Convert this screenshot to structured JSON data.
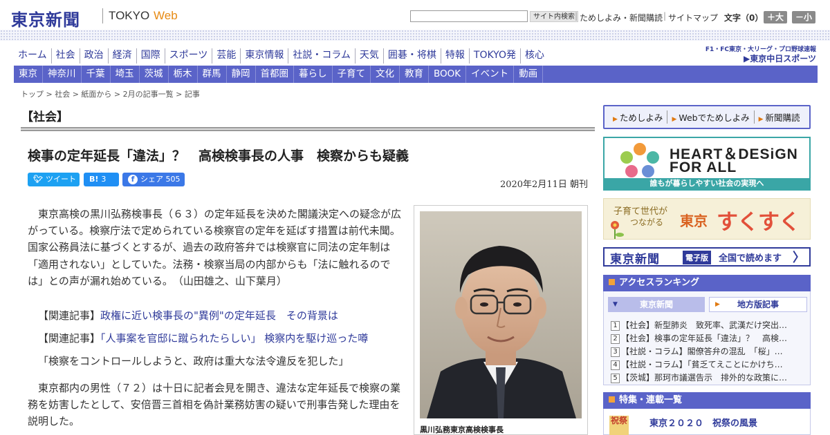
{
  "header": {
    "logo_main": "東京新聞",
    "logo_tokyo": "TOKYO",
    "logo_web": "Web",
    "search_button": "サイト内検索",
    "link_trial": "ためしよみ・新聞購読",
    "link_sitemap": "サイトマップ",
    "separator": "|",
    "font_size_label": "文字（0）",
    "font_bigger": "＋大",
    "font_smaller": "－小"
  },
  "main_nav": [
    "ホーム",
    "社会",
    "政治",
    "経済",
    "国際",
    "スポーツ",
    "芸能",
    "東京情報",
    "社説・コラム",
    "天気",
    "囲碁・将棋",
    "特報",
    "TOKYO発",
    "核心"
  ],
  "sports_logo": {
    "line1": "F1・FC東京・大リーグ・プロ野球速報",
    "line2": "▶東京中日スポーツ"
  },
  "region_nav": [
    "東京",
    "神奈川",
    "千葉",
    "埼玉",
    "茨城",
    "栃木",
    "群馬",
    "静岡",
    "首都圏",
    "暮らし",
    "子育て",
    "文化",
    "教育",
    "BOOK",
    "イベント",
    "動画"
  ],
  "breadcrumb": "トップ > 社会 > 紙面から > 2月の記事一覧 > 記事",
  "section_label": "【社会】",
  "article": {
    "title": "検事の定年延長「違法」？　高検検事長の人事　検察からも疑義",
    "date": "2020年2月11日 朝刊",
    "lead": "東京高検の黒川弘務検事長（６３）の定年延長を決めた閣議決定への疑念が広がっている。検察庁法で定められている検察官の定年を延ばす措置は前代未聞。国家公務員法に基づくとするが、過去の政府答弁では検察官に同法の定年制は「適用されない」としていた。法務・検察当局の内部からも「法に触れるのでは」との声が漏れ始めている。　（山田雄之、山下葉月）",
    "related": [
      {
        "prefix": "【関連記事】",
        "link": "政権に近い検事長の\"異例\"の定年延長　その背景は"
      },
      {
        "prefix": "【関連記事】",
        "link": "「人事案を官邸に蹴られたらしい」 検察内を駆け巡った噂"
      }
    ],
    "quote": "「検察をコントロールしようと、政府は重大な法令違反を犯した」",
    "body2": "東京都内の男性（７２）は十日に記者会見を開き、違法な定年延長で検察の業務を妨害したとして、安倍晋三首相を偽計業務妨害の疑いで刑事告発した理由を説明した。",
    "photo_caption": "黒川弘務東京高検検事長"
  },
  "social": {
    "tweet": "ツイート",
    "hatena_label": "B!",
    "hatena_count": "3",
    "share": "シェア",
    "share_count": "505"
  },
  "sidebar": {
    "subscribe": [
      "ためしよみ",
      "Webでためしよみ",
      "新聞購読"
    ],
    "heart_design": {
      "line1": "HEART＆DESiGN",
      "line2": "FOR ALL",
      "strip": "誰もが暮らしやすい社会の実現へ"
    },
    "sukusuku": {
      "sub1": "子育て世代が",
      "sub2": "つながる",
      "tokyo": "東京",
      "main": "すくすく"
    },
    "digital": {
      "logo": "東京新聞",
      "badge": "電子版",
      "text": "全国で読めます",
      "arrow": "〉"
    },
    "ranking": {
      "title": "アクセスランキング",
      "tab_tokyo": "東京新聞",
      "tab_local": "地方版記事",
      "items": [
        {
          "num": "1",
          "text": "【社会】新型肺炎　致死率、武漢だけ突出…"
        },
        {
          "num": "2",
          "text": "【社会】検事の定年延長「違法」？　高検…"
        },
        {
          "num": "3",
          "text": "【社説・コラム】閣僚答弁の混乱　「桜」…"
        },
        {
          "num": "4",
          "text": "【社説・コラム】「貧乏てえことにかけち…"
        },
        {
          "num": "5",
          "text": "【茨城】那珂市議選告示　排外的な政策に…"
        }
      ]
    },
    "feature": {
      "title": "特集・連載一覧",
      "thumb": "祝祭",
      "item": "東京２０２０　祝祭の風景"
    }
  },
  "colors": {
    "brand_blue": "#2f3a9a",
    "nav_purple": "#5a63c8",
    "accent_orange": "#e78a13",
    "teal": "#3aa6a6"
  }
}
